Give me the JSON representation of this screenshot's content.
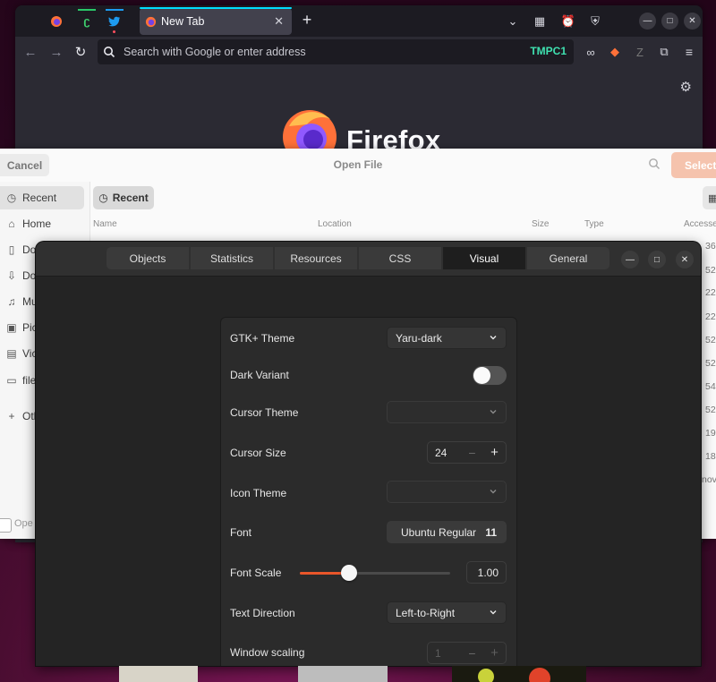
{
  "firefox": {
    "tab_title": "New Tab",
    "new_tab_symbol": "+",
    "url_placeholder": "Search with Google or enter address",
    "container_label": "TMPC1",
    "brand_wordmark": "Firefox",
    "accent_color": "#00ddff"
  },
  "open_file": {
    "title": "Open File",
    "cancel_label": "Cancel",
    "select_label": "Select",
    "location_pill": "Recent",
    "sidebar": [
      {
        "label": "Recent",
        "icon": "clock-icon"
      },
      {
        "label": "Home",
        "icon": "home-icon"
      },
      {
        "label": "Do",
        "icon": "document-icon"
      },
      {
        "label": "Do",
        "icon": "download-icon"
      },
      {
        "label": "Mu",
        "icon": "music-icon"
      },
      {
        "label": "Pic",
        "icon": "picture-icon"
      },
      {
        "label": "Vic",
        "icon": "video-icon"
      },
      {
        "label": "file",
        "icon": "folder-icon"
      },
      {
        "label": "Oth",
        "icon": "plus-icon"
      }
    ],
    "columns": [
      "Name",
      "Location",
      "Size",
      "Type",
      "Accesse"
    ],
    "right_fragments": [
      "36",
      "52",
      "22",
      "22",
      "52",
      "52",
      "54",
      "52",
      "19",
      "18",
      "nov"
    ],
    "footer_fragment": "Ope"
  },
  "inspector": {
    "tabs": [
      {
        "label": "Objects",
        "active": false
      },
      {
        "label": "Statistics",
        "active": false
      },
      {
        "label": "Resources",
        "active": false
      },
      {
        "label": "CSS",
        "active": false
      },
      {
        "label": "Visual",
        "active": true
      },
      {
        "label": "General",
        "active": false
      }
    ],
    "visual": {
      "gtk_theme_label": "GTK+ Theme",
      "gtk_theme_value": "Yaru-dark",
      "dark_variant_label": "Dark Variant",
      "dark_variant_on": false,
      "cursor_theme_label": "Cursor Theme",
      "cursor_theme_value": "",
      "cursor_size_label": "Cursor Size",
      "cursor_size_value": "24",
      "icon_theme_label": "Icon Theme",
      "icon_theme_value": "",
      "font_label": "Font",
      "font_name": "Ubuntu Regular",
      "font_size": "11",
      "font_scale_label": "Font Scale",
      "font_scale_value": "1.00",
      "font_scale_slider_fraction": 0.33,
      "text_direction_label": "Text Direction",
      "text_direction_value": "Left-to-Right",
      "window_scaling_label": "Window scaling",
      "window_scaling_value": "1"
    },
    "accent_color": "#e9562a"
  }
}
